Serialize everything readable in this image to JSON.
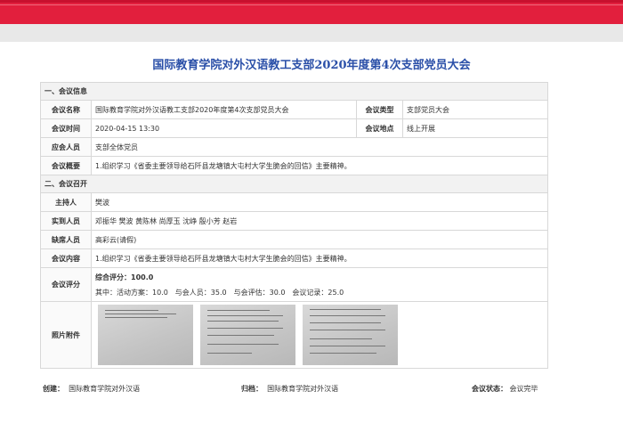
{
  "title": "国际教育学院对外汉语教工支部2020年度第4次支部党员大会",
  "section1": "一、会议信息",
  "info": {
    "name_label": "会议名称",
    "name": "国际教育学院对外汉语教工支部2020年度第4次支部党员大会",
    "type_label": "会议类型",
    "type": "支部党员大会",
    "time_label": "会议时间",
    "time": "2020-04-15 13:30",
    "place_label": "会议地点",
    "place": "线上开展",
    "attendees_label": "应会人员",
    "attendees": "支部全体党员",
    "summary_label": "会议概要",
    "summary": "1.组织学习《省委主要领导给石阡县龙塘镇大屯村大学生脆会的回信》主要精神。"
  },
  "section2": "二、会议召开",
  "held": {
    "host_label": "主持人",
    "host": "樊波",
    "present_label": "实到人员",
    "present": "邓振华 樊波 黄陈林 尚厚玉 沈峥 殷小芳 赵岩",
    "absent_label": "缺席人员",
    "absent": "高彩云(请假)",
    "content_label": "会议内容",
    "content": "1.组织学习《省委主要领导给石阡县龙塘镇大屯村大学生脆会的回信》主要精神。",
    "score_label": "会议评分",
    "score_total": "综合评分：100.0",
    "score_detail": "其中：活动方案：10.0　与会人员：35.0　与会评估：30.0　会议记录：25.0",
    "photos_label": "照片附件"
  },
  "footer": {
    "creator_label": "创建：",
    "creator": "国际教育学院对外汉语",
    "archive_label": "归档：",
    "archive": "国际教育学院对外汉语",
    "status_label": "会议状态：",
    "status": "会议完毕"
  }
}
